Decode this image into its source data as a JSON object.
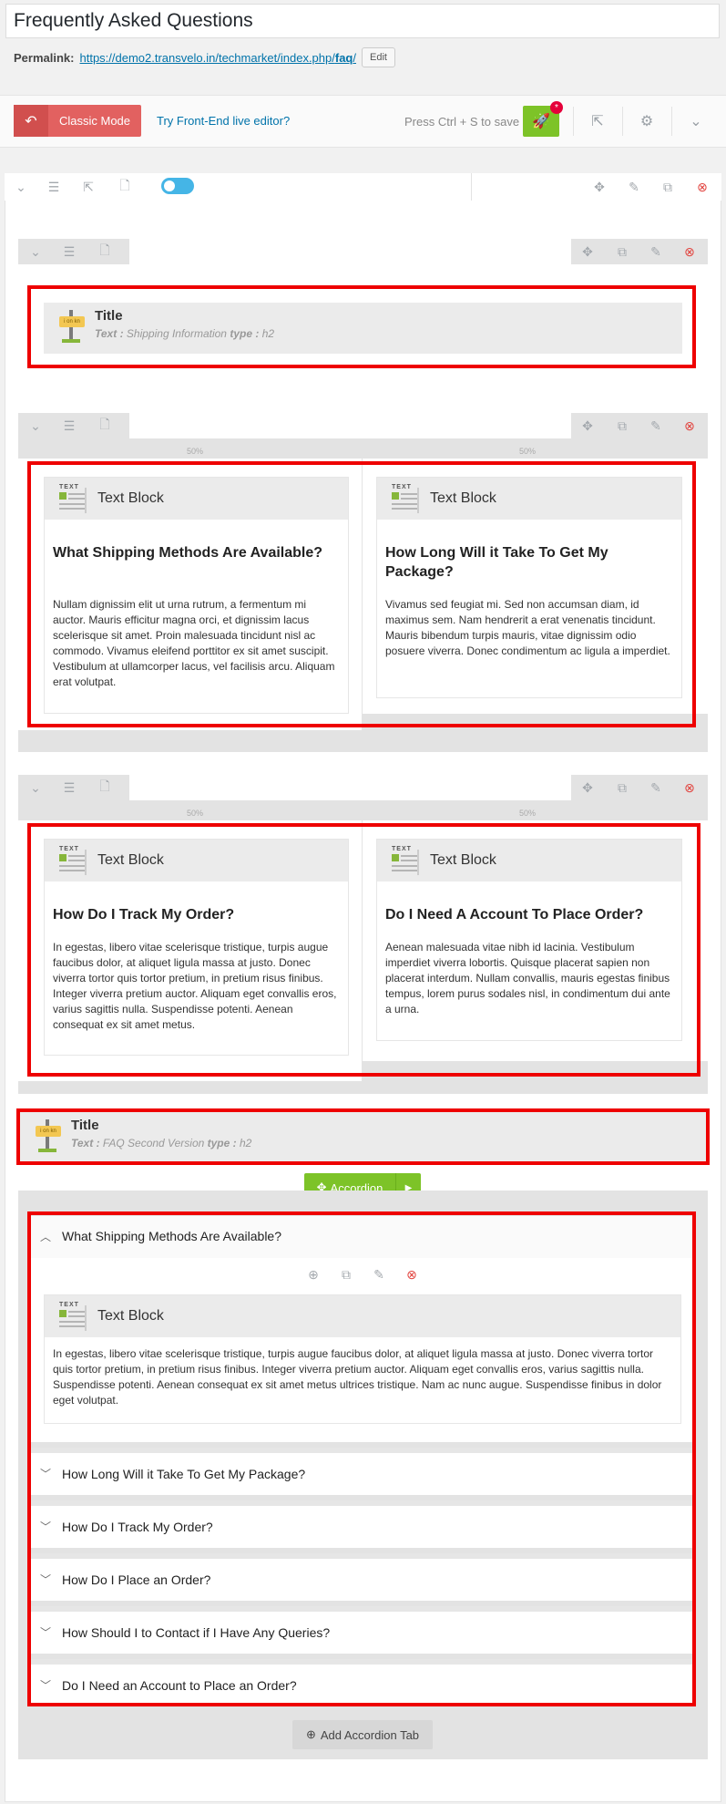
{
  "post": {
    "title": "Frequently Asked Questions",
    "permalink_label": "Permalink:",
    "permalink_base": "https://demo2.transvelo.in/techmarket/index.php/",
    "permalink_slug": "faq",
    "permalink_tail": "/",
    "edit_label": "Edit"
  },
  "composer_toolbar": {
    "classic_mode_label": "Classic Mode",
    "frontend_label": "Try Front-End live editor?",
    "save_hint": "Press Ctrl + S to save",
    "badge": "*"
  },
  "percent_label": "50%",
  "row1_title": {
    "name": "Title",
    "text_key": "Text :",
    "text_val": "Shipping Information",
    "type_key": "type :",
    "type_val": "h2",
    "sign_text": "i on kn"
  },
  "row2": {
    "left": {
      "element": "Text Block",
      "heading": "What Shipping Methods Are Available?",
      "body": "Nullam dignissim elit ut urna rutrum, a fermentum mi auctor. Mauris efficitur magna orci, et dignissim lacus scelerisque sit amet. Proin malesuada tincidunt nisl ac commodo. Vivamus eleifend porttitor ex sit amet suscipit. Vestibulum at ullamcorper lacus, vel facilisis arcu. Aliquam erat volutpat."
    },
    "right": {
      "element": "Text Block",
      "heading": "How Long Will it Take To Get My Package?",
      "body": "Vivamus sed feugiat mi. Sed non accumsan diam, id maximus sem. Nam hendrerit a erat venenatis tincidunt. Mauris bibendum turpis mauris, vitae dignissim odio posuere viverra. Donec condimentum ac ligula a imperdiet."
    }
  },
  "row3": {
    "left": {
      "element": "Text Block",
      "heading": "How Do I Track My Order?",
      "body": "In egestas, libero vitae scelerisque tristique, turpis augue faucibus dolor, at aliquet ligula massa at justo. Donec viverra tortor quis tortor pretium, in pretium risus finibus. Integer viverra pretium auctor. Aliquam eget convallis eros, varius sagittis nulla. Suspendisse potenti. Aenean consequat ex sit amet metus."
    },
    "right": {
      "element": "Text Block",
      "heading": "Do I Need A Account To Place Order?",
      "body": "Aenean malesuada vitae nibh id lacinia. Vestibulum imperdiet viverra lobortis. Quisque placerat sapien non placerat interdum. Nullam convallis, mauris egestas finibus tempus, lorem purus sodales nisl, in condimentum dui ante a urna."
    }
  },
  "title2": {
    "name": "Title",
    "text_key": "Text :",
    "text_val": "FAQ Second Version",
    "type_key": "type :",
    "type_val": "h2",
    "sign_text": "i on kn"
  },
  "accordion": {
    "label": "Accordion",
    "open_item": {
      "title": "What Shipping Methods Are Available?",
      "element": "Text Block",
      "body": "In egestas, libero vitae scelerisque tristique, turpis augue faucibus dolor, at aliquet ligula massa at justo. Donec viverra tortor quis tortor pretium, in pretium risus finibus. Integer viverra pretium auctor. Aliquam eget convallis eros, varius sagittis nulla. Suspendisse potenti. Aenean consequat ex sit amet metus ultrices tristique. Nam ac nunc augue. Suspendisse finibus in dolor eget volutpat."
    },
    "items": [
      "How Long Will it Take To Get My Package?",
      "How Do I Track My Order?",
      "How Do I Place an Order?",
      "How Should I to Contact if I Have Any Queries?",
      "Do I Need an Account to Place an Order?"
    ],
    "add_tab_label": "Add Accordion Tab"
  },
  "text_icon_label": "TEXT",
  "icons": {
    "collapse": "chevron-down-icon",
    "layout": "list-icon",
    "external": "external-link-icon",
    "add_element": "add-document-icon",
    "move": "move-icon",
    "edit": "edit-icon",
    "clone": "clone-icon",
    "delete": "delete-icon",
    "settings": "gear-icon",
    "save": "rocket-icon",
    "add": "plus-circle-icon"
  },
  "colors": {
    "classic_mode": "#e26160",
    "save": "#7dc328",
    "highlight": "#ee0000",
    "toggle": "#45b5e6",
    "link": "#0073aa"
  }
}
